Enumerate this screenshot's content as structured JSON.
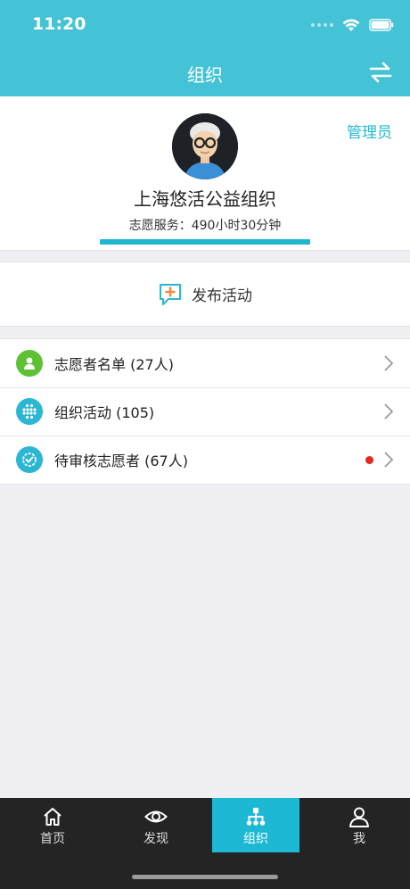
{
  "status_bar": {
    "time": "11:20"
  },
  "nav": {
    "title": "组织"
  },
  "profile": {
    "role_label": "管理员",
    "org_name": "上海悠活公益组织",
    "service_label": "志愿服务：",
    "service_time": "490小时30分钟"
  },
  "publish": {
    "label": "发布活动"
  },
  "menu": {
    "items": [
      {
        "label": "志愿者名单 (27人)",
        "icon": "person-icon",
        "color": "#5dc133"
      },
      {
        "label": "组织活动 (105)",
        "icon": "dots-grid-icon",
        "color": "#2bb6d3"
      },
      {
        "label": "待审核志愿者 (67人)",
        "icon": "check-badge-icon",
        "color": "#2bb6d3",
        "has_notification": true
      }
    ]
  },
  "tabbar": {
    "items": [
      {
        "label": "首页",
        "icon": "home-icon"
      },
      {
        "label": "发现",
        "icon": "eye-icon"
      },
      {
        "label": "组织",
        "icon": "org-chart-icon",
        "active": true
      },
      {
        "label": "我",
        "icon": "user-icon"
      }
    ]
  },
  "colors": {
    "header": "#45c3d6",
    "accent": "#1cb8d4",
    "tabbar": "#242424",
    "notification": "#e6261f"
  }
}
